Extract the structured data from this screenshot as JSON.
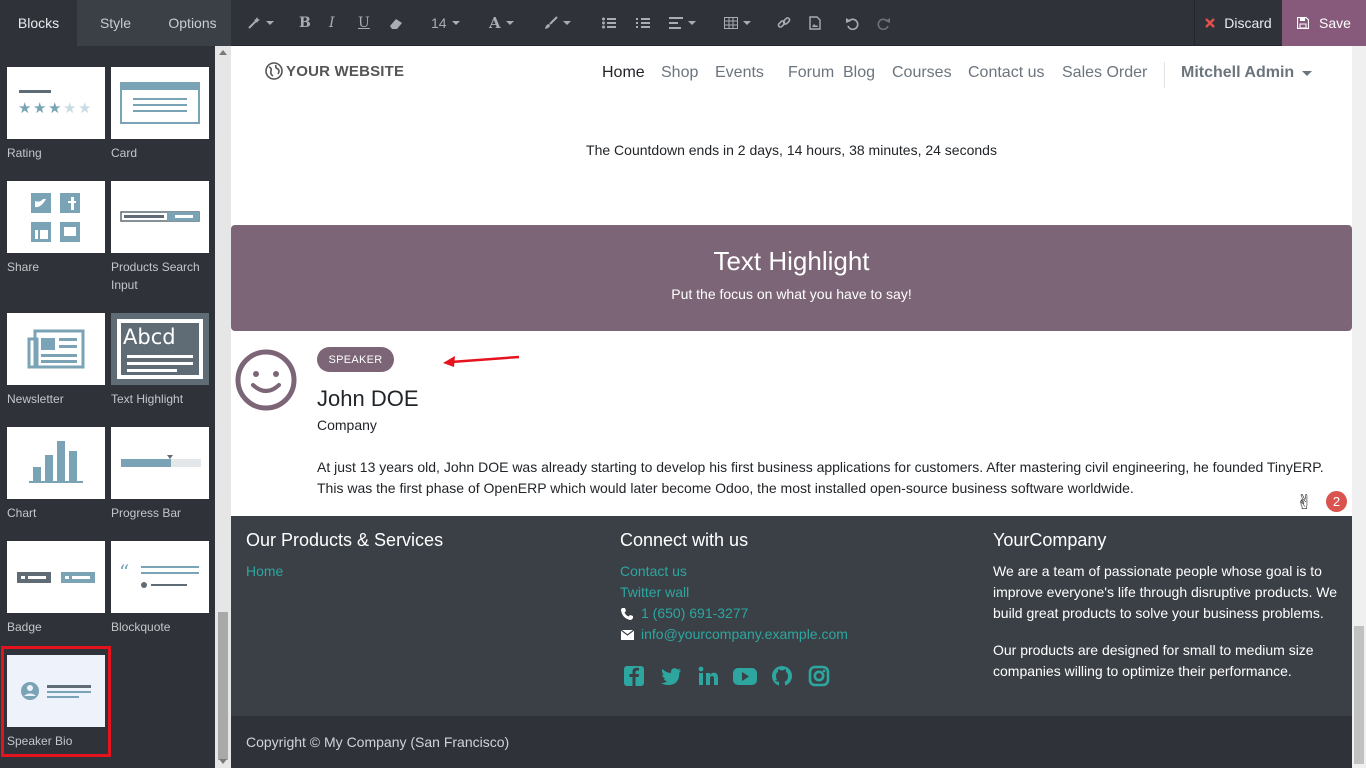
{
  "sidebar": {
    "tabs": [
      {
        "label": "Blocks",
        "active": true
      },
      {
        "label": "Style",
        "active": false
      },
      {
        "label": "Options",
        "active": false
      }
    ],
    "snippets": {
      "rating": "Rating",
      "card": "Card",
      "share": "Share",
      "products_search": "Products Search Input",
      "newsletter": "Newsletter",
      "text_highlight": "Text Highlight",
      "text_highlight_thumb": "Abcd",
      "chart": "Chart",
      "progress_bar": "Progress Bar",
      "badge": "Badge",
      "blockquote": "Blockquote",
      "speaker_bio": "Speaker Bio"
    }
  },
  "toolbar": {
    "font_size": "14",
    "discard_label": "Discard",
    "save_label": "Save"
  },
  "navbar": {
    "logo_text": "YOUR WEBSITE",
    "links": [
      "Home",
      "Shop",
      "Events",
      "Forum",
      "Blog",
      "Courses",
      "Contact us",
      "Sales Order"
    ],
    "active_link": "Home",
    "user": "Mitchell Admin"
  },
  "countdown_text": "The Countdown ends in 2 days, 14 hours, 38 minutes, 24 seconds",
  "highlight": {
    "title": "Text Highlight",
    "subtitle": "Put the focus on what you have to say!"
  },
  "speaker": {
    "badge": "SPEAKER",
    "name": "John DOE",
    "company": "Company",
    "bio": "At just 13 years old, John DOE was already starting to develop his first business applications for customers. After mastering civil engineering, he founded TinyERP. This was the first phase of OpenERP which would later become Odoo, the most installed open-source business software worldwide."
  },
  "notification_count": "2",
  "footer": {
    "col1": {
      "heading": "Our Products & Services",
      "links": [
        "Home"
      ]
    },
    "col2": {
      "heading": "Connect with us",
      "links": [
        "Contact us",
        "Twitter wall"
      ],
      "phone": "1 (650) 691-3277",
      "email": "info@yourcompany.example.com",
      "social": [
        "facebook-icon",
        "twitter-icon",
        "linkedin-icon",
        "youtube-icon",
        "github-icon",
        "instagram-icon"
      ]
    },
    "col3": {
      "heading": "YourCompany",
      "para1": "We are a team of passionate people whose goal is to improve everyone's life through disruptive products. We build great products to solve your business problems.",
      "para2": "Our products are designed for small to medium size companies willing to optimize their performance."
    }
  },
  "copyright": "Copyright © My Company (San Francisco)",
  "colors": {
    "brand": "#875a7b",
    "highlight_bg": "#7c6576",
    "link": "#2da6a0",
    "footer_bg": "#3b4046",
    "annotation_red": "#e4131e"
  }
}
